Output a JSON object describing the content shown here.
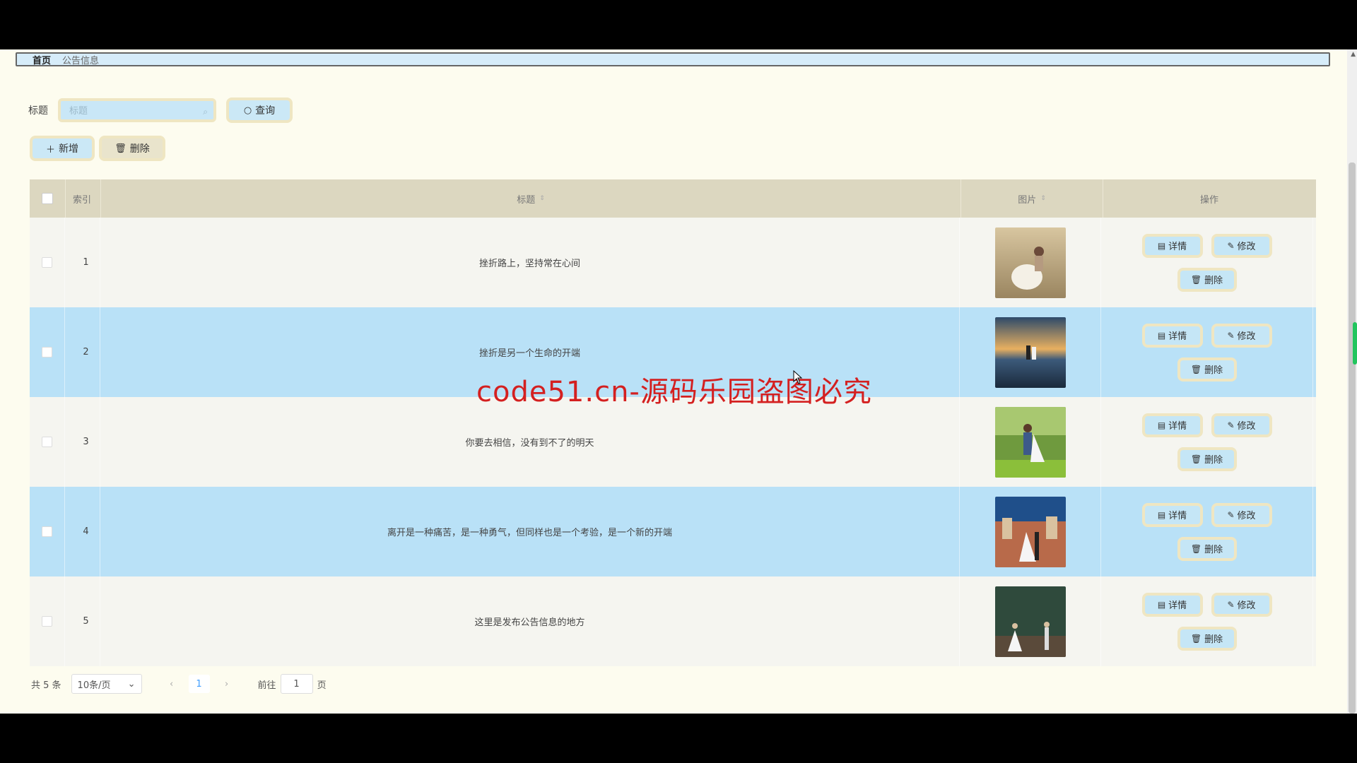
{
  "breadcrumb": {
    "home": "首页",
    "current": "公告信息"
  },
  "search": {
    "label": "标题",
    "placeholder": "标题",
    "query_button": "查询"
  },
  "toolbar": {
    "add_button": "新增",
    "delete_button": "删除"
  },
  "table": {
    "headers": {
      "index": "索引",
      "title": "标题",
      "image": "图片",
      "actions": "操作"
    },
    "rows": [
      {
        "index": "1",
        "title": "挫折路上，坚持常在心间",
        "image": "couple-field-photo"
      },
      {
        "index": "2",
        "title": "挫折是另一个生命的开端",
        "image": "couple-sunset-water-photo"
      },
      {
        "index": "3",
        "title": "你要去相信，没有到不了的明天",
        "image": "couple-garden-photo"
      },
      {
        "index": "4",
        "title": "离开是一种痛苦，是一种勇气，但同样也是一个考验，是一个新的开端",
        "image": "couple-castle-photo"
      },
      {
        "index": "5",
        "title": "这里是发布公告信息的地方",
        "image": "wedding-stage-photo"
      }
    ],
    "row_actions": {
      "detail": "详情",
      "edit": "修改",
      "delete": "删除"
    }
  },
  "pagination": {
    "total": "共 5 条",
    "page_size": "10条/页",
    "current_page": "1",
    "goto_label": "前往",
    "goto_value": "1",
    "page_suffix": "页"
  },
  "watermark": "code51.cn-源码乐园盗图必究",
  "colors": {
    "background": "#fdfcef",
    "header": "#dcd7c0",
    "highlight_row": "#b9e1f7",
    "accent": "#409eff"
  }
}
